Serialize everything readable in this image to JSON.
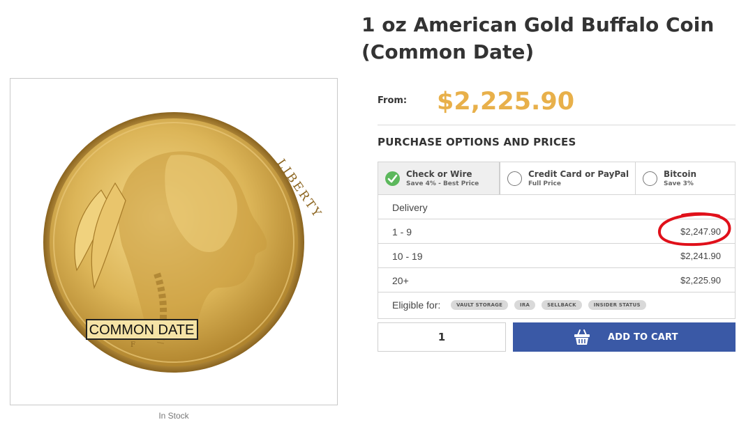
{
  "product": {
    "title_line1": "1 oz American Gold Buffalo Coin",
    "title_line2": "(Common Date)",
    "from_label": "From:",
    "from_price": "$2,225.90",
    "stock_status": "In Stock",
    "image_caption": "COMMON DATE",
    "coin_text": "LIBERTY"
  },
  "purchase": {
    "heading": "PURCHASE OPTIONS AND PRICES",
    "payment_options": [
      {
        "name": "Check or Wire",
        "sub": "Save 4% - Best Price",
        "selected": true
      },
      {
        "name": "Credit Card or PayPal",
        "sub": "Full Price",
        "selected": false
      },
      {
        "name": "Bitcoin",
        "sub": "Save 3%",
        "selected": false
      }
    ],
    "delivery_label": "Delivery",
    "tiers": [
      {
        "qty": "1 - 9",
        "price": "$2,247.90"
      },
      {
        "qty": "10 - 19",
        "price": "$2,241.90"
      },
      {
        "qty": "20+",
        "price": "$2,225.90"
      }
    ],
    "eligible_label": "Eligible for:",
    "eligible_badges": [
      "VAULT STORAGE",
      "IRA",
      "SELLBACK",
      "INSIDER STATUS"
    ],
    "quantity_value": "1",
    "add_to_cart_label": "ADD TO CART"
  },
  "colors": {
    "price_accent": "#e8b04a",
    "cart_button": "#3a59a6",
    "check_green": "#5cb85c",
    "annotation_red": "#e0101a"
  },
  "icons": [
    "check-icon",
    "radio-icon",
    "cart-basket-icon",
    "coin-image"
  ]
}
